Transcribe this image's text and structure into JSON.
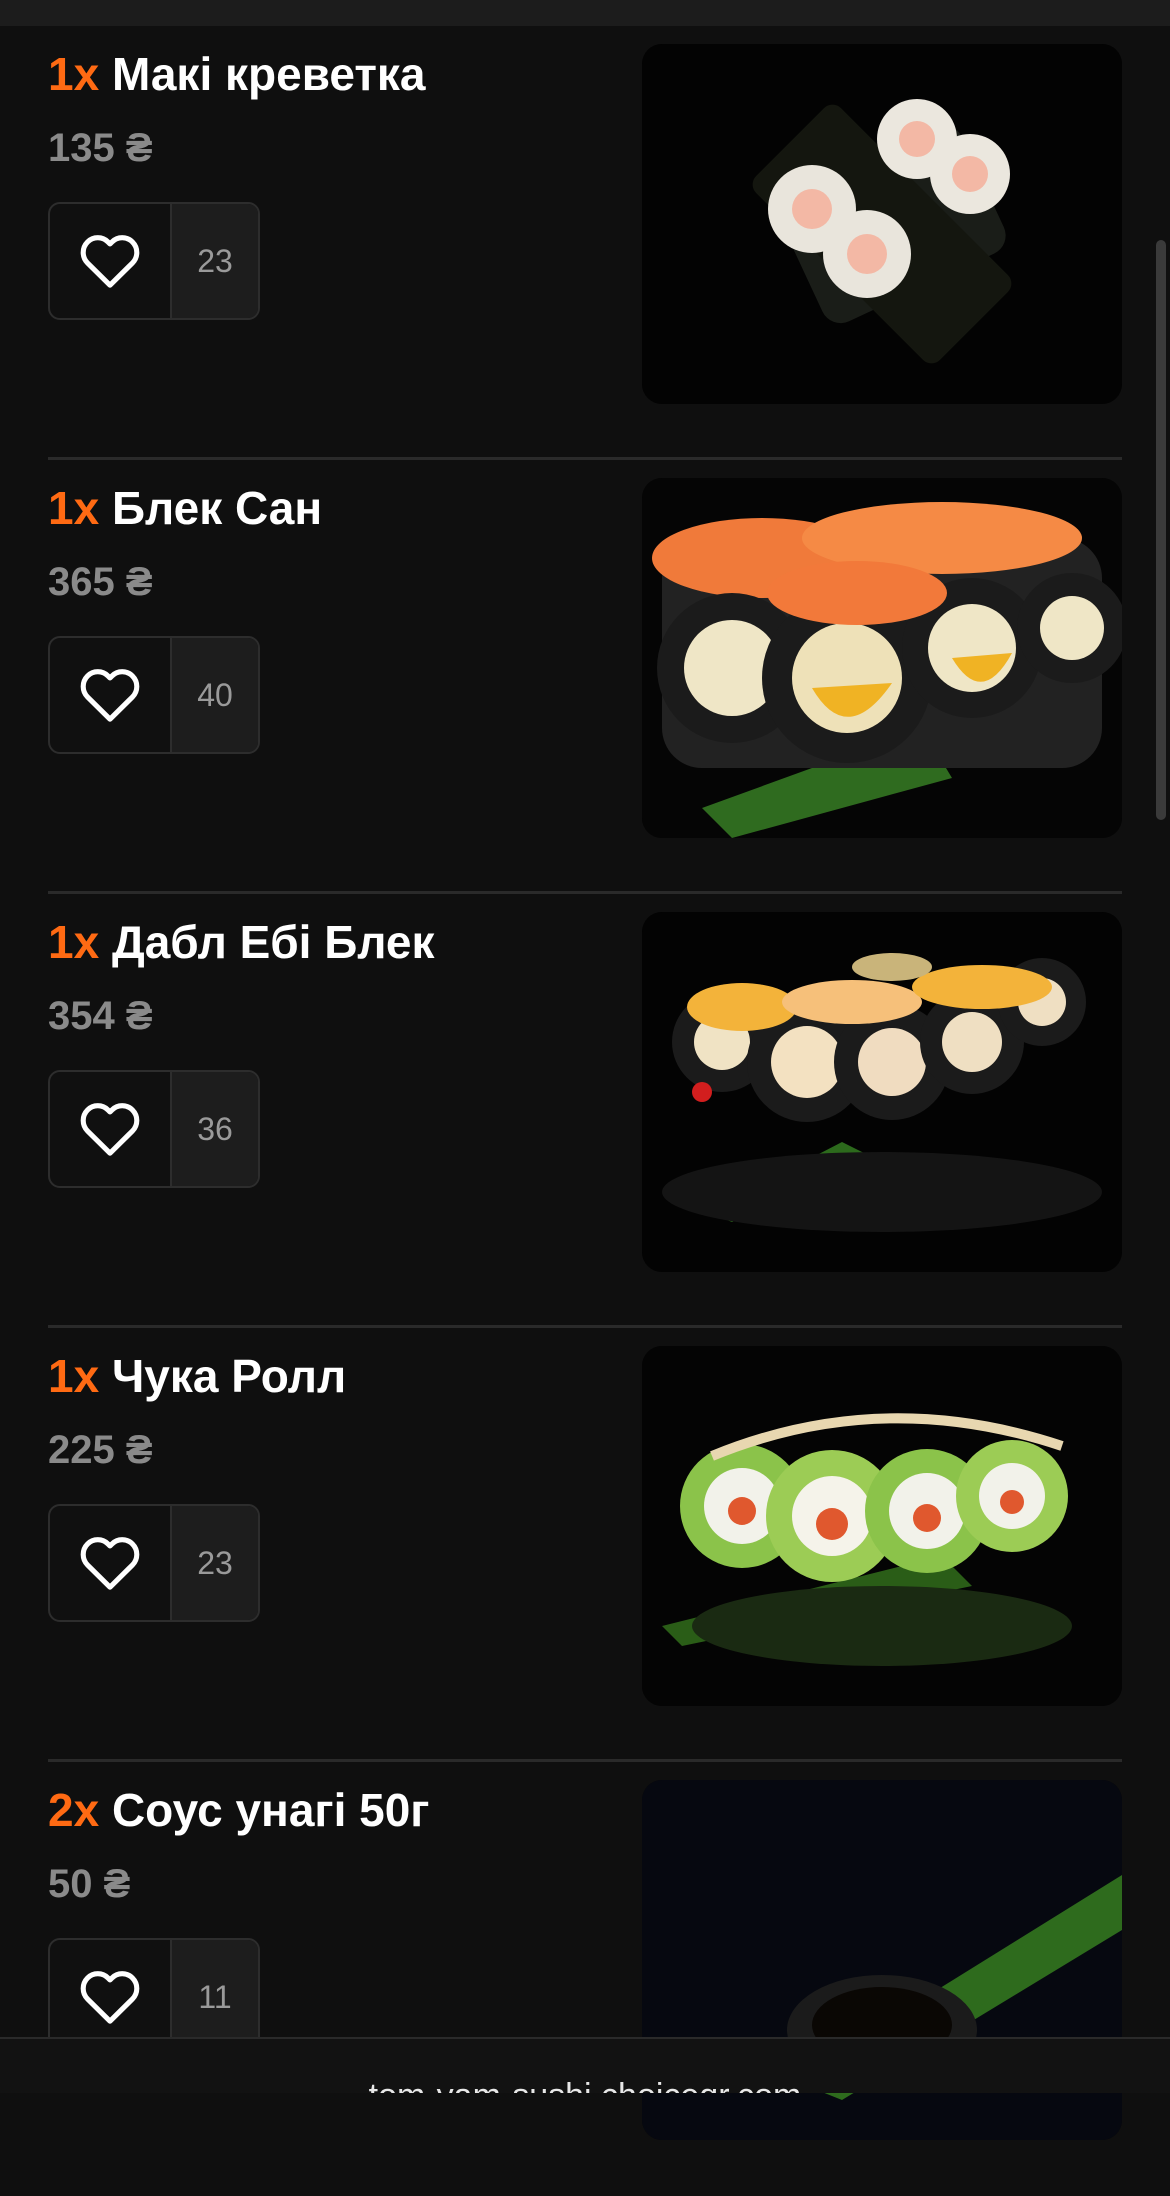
{
  "items": [
    {
      "qty": "1x",
      "name": "Макі креветка",
      "price": "135 ₴",
      "likes": "23",
      "image_desc": "maki-shrimp"
    },
    {
      "qty": "1x",
      "name": "Блек Сан",
      "price": "365 ₴",
      "likes": "40",
      "image_desc": "black-san-roll"
    },
    {
      "qty": "1x",
      "name": "Дабл Ебі Блек",
      "price": "354 ₴",
      "likes": "36",
      "image_desc": "double-ebi-black-roll"
    },
    {
      "qty": "1x",
      "name": "Чука Ролл",
      "price": "225 ₴",
      "likes": "23",
      "image_desc": "chuka-roll"
    },
    {
      "qty": "2x",
      "name": "Соус унагі 50г",
      "price": "50 ₴",
      "likes": "11",
      "image_desc": "unagi-sauce"
    }
  ],
  "footer": {
    "url": "tom-yam-sushi.choiceqr.com"
  },
  "colors": {
    "accent": "#ff6a13",
    "background": "#0f0f0f",
    "price": "#8a8a8a"
  },
  "icons": {
    "like": "heart-icon"
  }
}
